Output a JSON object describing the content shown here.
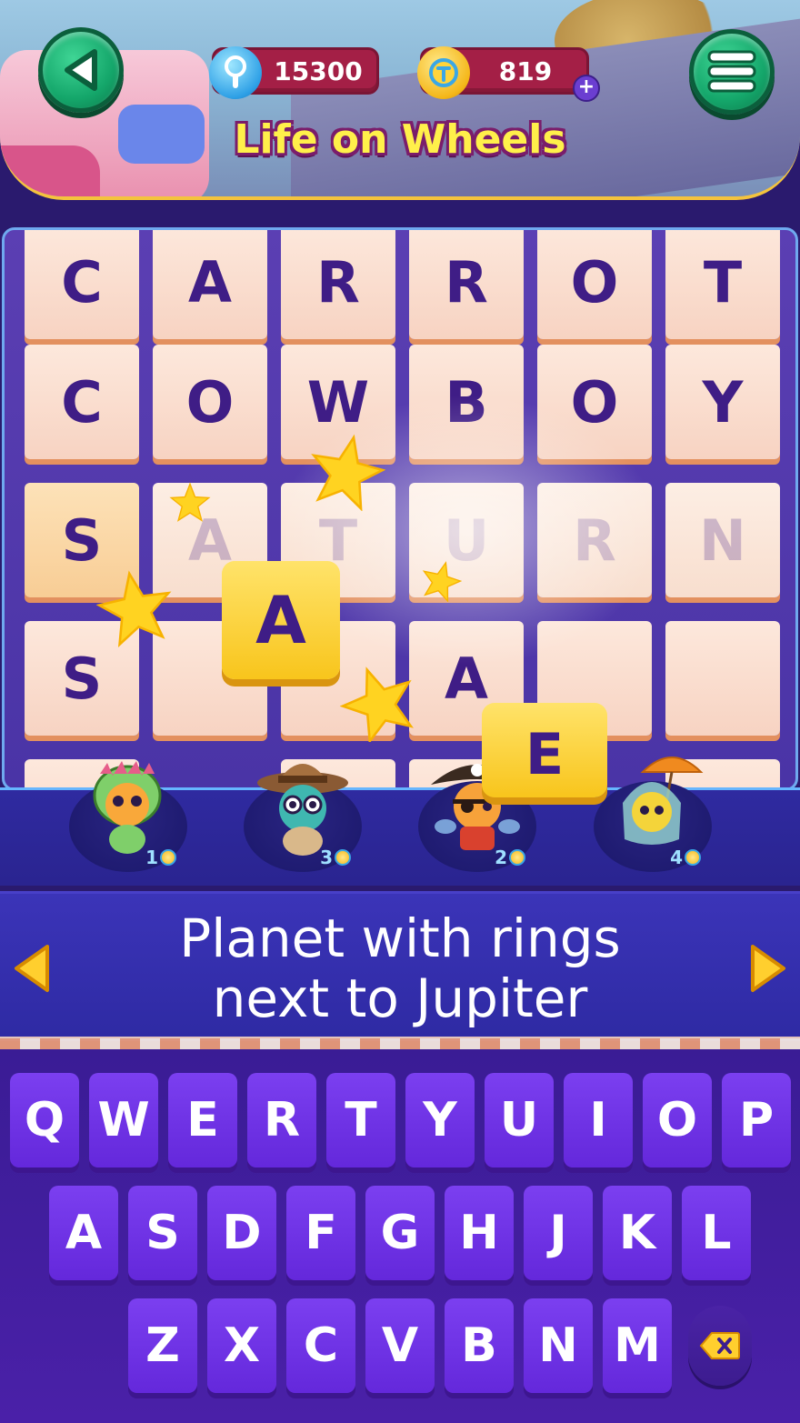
{
  "header": {
    "level_title": "Life on Wheels",
    "gems": "15300",
    "coins": "819",
    "add_coins_label": "+"
  },
  "board": {
    "rows": [
      [
        "C",
        "A",
        "R",
        "R",
        "O",
        "T"
      ],
      [
        "C",
        "O",
        "W",
        "B",
        "O",
        "Y"
      ],
      [
        "S",
        "A",
        "T",
        "U",
        "R",
        "N"
      ],
      [
        "S",
        "",
        "",
        "A",
        "",
        ""
      ]
    ],
    "faded_cells": [
      [
        2,
        1
      ],
      [
        2,
        2
      ],
      [
        2,
        3
      ],
      [
        2,
        4
      ],
      [
        2,
        5
      ]
    ],
    "flying_letters": [
      "A",
      "E"
    ]
  },
  "helpers": [
    {
      "name": "dino-helper",
      "cost": "1"
    },
    {
      "name": "explorer-helper",
      "cost": "3"
    },
    {
      "name": "pirate-helper",
      "cost": "2"
    },
    {
      "name": "umbrella-helper",
      "cost": "4"
    }
  ],
  "clue": {
    "line1": "Planet with rings",
    "line2": "next to Jupiter"
  },
  "keyboard": {
    "row1": [
      "Q",
      "W",
      "E",
      "R",
      "T",
      "Y",
      "U",
      "I",
      "O",
      "P"
    ],
    "row2": [
      "A",
      "S",
      "D",
      "F",
      "G",
      "H",
      "J",
      "K",
      "L"
    ],
    "row3": [
      "Z",
      "X",
      "C",
      "V",
      "B",
      "N",
      "M"
    ]
  },
  "colors": {
    "accent_yellow": "#fff04a",
    "tile_text": "#3f1d86",
    "key_purple": "#6428db",
    "menu_green": "#14a66a"
  }
}
